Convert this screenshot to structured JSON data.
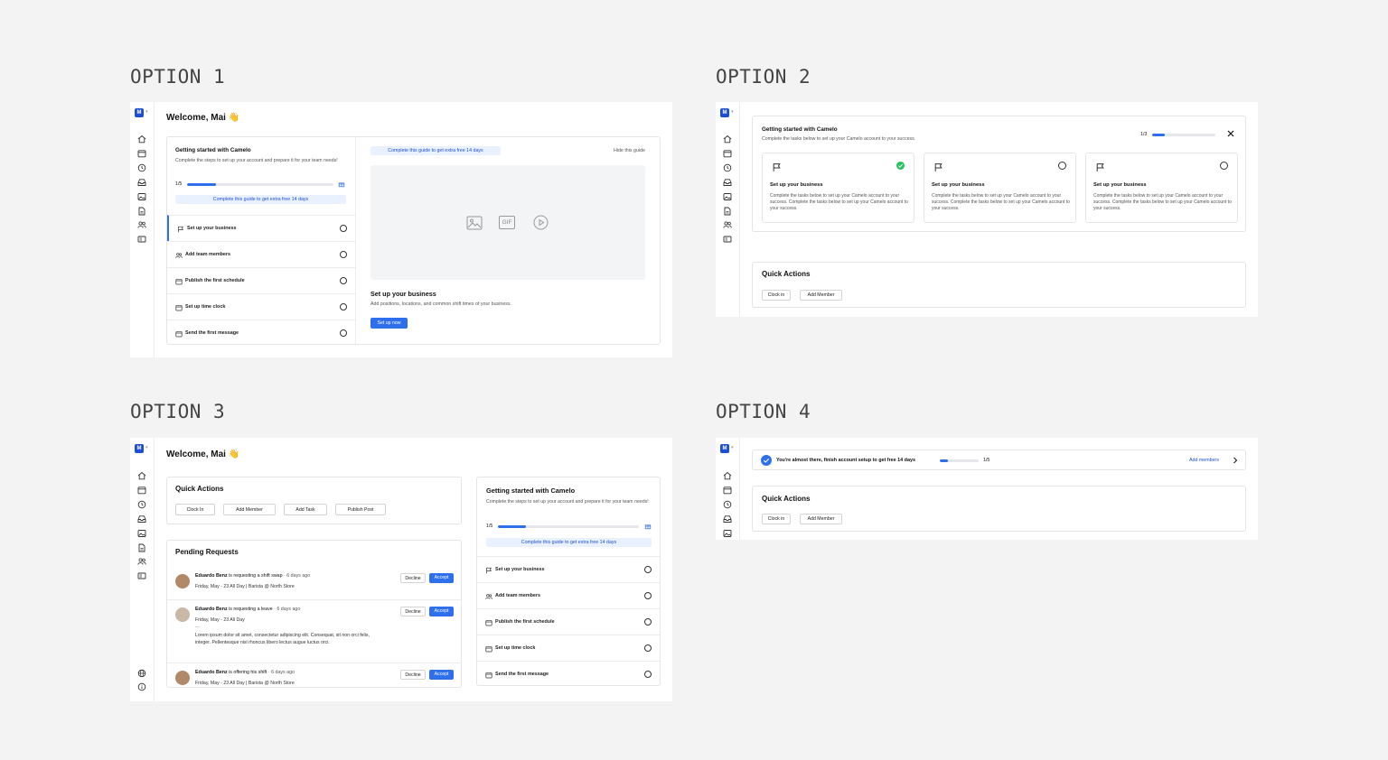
{
  "options": {
    "o1": "OPTION 1",
    "o2": "OPTION 2",
    "o3": "OPTION 3",
    "o4": "OPTION 4"
  },
  "app": {
    "logo": "M",
    "welcome": "Welcome, Mai 👋"
  },
  "guide": {
    "title": "Getting started with Camelo",
    "desc": "Complete the steps to set up your account and prepare it for your team needs!",
    "progress_text": "1/5",
    "progress": 0.2,
    "promo": "Complete this guide to get extra free 14 days",
    "hide": "Hide this guide",
    "steps": [
      {
        "label": "Set up your business",
        "icon": "flag-icon"
      },
      {
        "label": "Add team members",
        "icon": "users-icon"
      },
      {
        "label": "Publish the first schedule",
        "icon": "calendar-icon"
      },
      {
        "label": "Set up time clock",
        "icon": "calendar-icon"
      },
      {
        "label": "Send the first message",
        "icon": "calendar-icon"
      }
    ],
    "detail_title": "Set up your business",
    "detail_desc": "Add positions, locations, and common shift times of your business.",
    "detail_btn": "Set up now",
    "media_gif": "GIF"
  },
  "option2": {
    "title": "Getting started with Camelo",
    "desc": "Complete the tasks below to set up your Camelo account to your success.",
    "progress_text": "1/3",
    "progress": 0.2,
    "cards": [
      {
        "title": "Set up your business",
        "desc": "Complete the tasks below to set up your Camelo account to your success. Complete the tasks below to set up your Camelo account to your success.",
        "done": true
      },
      {
        "title": "Set up your business",
        "desc": "Complete the tasks below to set up your Camelo account to your success. Complete the tasks below to set up your Camelo account to your success.",
        "done": false
      },
      {
        "title": "Set up your business",
        "desc": "Complete the tasks below to set up your Camelo account to your success. Complete the tasks below to set up your Camelo account to your success.",
        "done": false
      }
    ]
  },
  "quick_actions": {
    "title": "Quick Actions",
    "clock_in": "Clock in",
    "clock_in_cap": "Clock In",
    "add_member": "Add Member",
    "add_task": "Add Task",
    "publish_post": "Publish Post"
  },
  "pending": {
    "title": "Pending Requests",
    "decline": "Decline",
    "accept": "Accept",
    "items": [
      {
        "name": "Eduardo Benz",
        "action": " is requesting a shift swap",
        "time": " · 6 days ago",
        "detail": "Friday, May - 23 All Day | Barista @ North Store",
        "note": ""
      },
      {
        "name": "Eduardo Benz",
        "action": " is requesting a leave",
        "time": " · 6 days ago",
        "detail": "Friday, May - 23 All Day",
        "note": "Lorem ipsum dolor sit amet, consectetur adipiscing elit. Consequat, sit non orci felis, integer. Pellentesque nisl rhoncus libero lectus augue luctus orci."
      },
      {
        "name": "Eduardo Benz",
        "action": " is offering his shift",
        "time": " · 6 days ago",
        "detail": "Friday, May - 23 All Day | Barista @ North Store",
        "note": ""
      }
    ]
  },
  "option4": {
    "banner": "You're almost there, finish account setup to get free 14 days",
    "progress_text": "1/5",
    "progress": 0.2,
    "link": "Add members"
  },
  "colors": {
    "accent": "#2f6fed",
    "success": "#22c55e"
  }
}
